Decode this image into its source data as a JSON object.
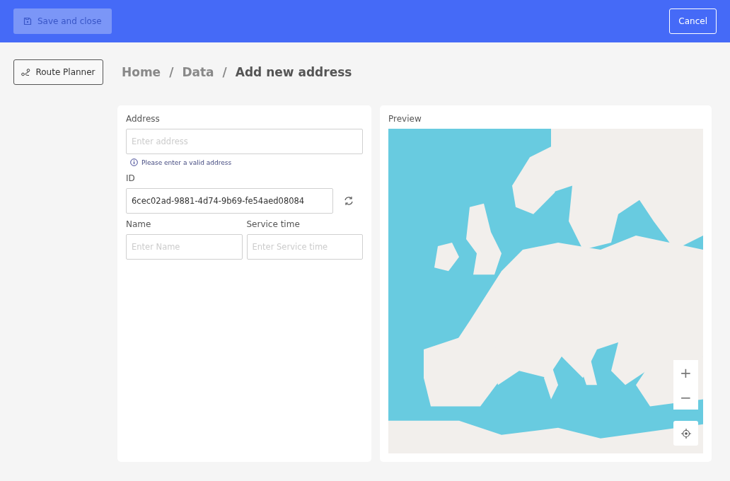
{
  "toolbar": {
    "save_button": {
      "label": "Save and close",
      "disabled": true
    },
    "cancel_button": {
      "label": "Cancel"
    }
  },
  "route_planner_button": {
    "label": "Route Planner"
  },
  "breadcrumb": [
    {
      "label": "Home",
      "current": false
    },
    {
      "label": "Data",
      "current": false
    },
    {
      "label": "Add new address",
      "current": true
    }
  ],
  "breadcrumb_separator": "/",
  "form": {
    "address": {
      "label": "Address",
      "placeholder": "Enter address",
      "hint": "Please enter a valid address"
    },
    "id": {
      "label": "ID",
      "value": "6cec02ad-9881-4d74-9b69-fe54aed08084"
    },
    "name": {
      "label": "Name",
      "placeholder": "Enter Name"
    },
    "service_time": {
      "label": "Service time",
      "placeholder": "Enter Service time"
    }
  },
  "preview": {
    "title": "Preview",
    "zoom_in": "+",
    "zoom_out": "−"
  }
}
